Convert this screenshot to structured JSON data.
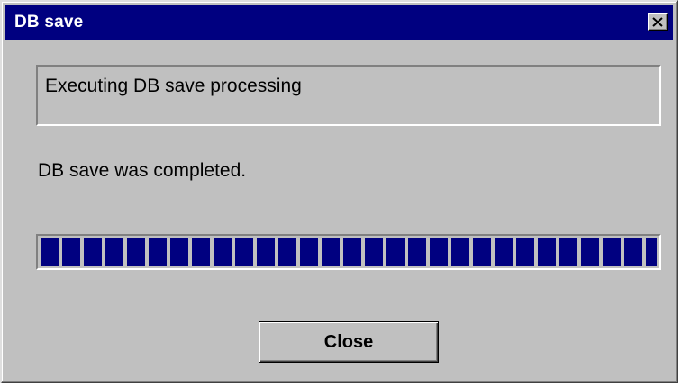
{
  "window": {
    "title": "DB save",
    "close_icon": "close-icon"
  },
  "main": {
    "group_text": "Executing DB save processing",
    "status_text": "DB save was completed.",
    "progress_percent": 100,
    "close_button_label": "Close"
  },
  "colors": {
    "titlebar": "#000080",
    "face": "#c0c0c0",
    "progress_fill": "#000080"
  }
}
